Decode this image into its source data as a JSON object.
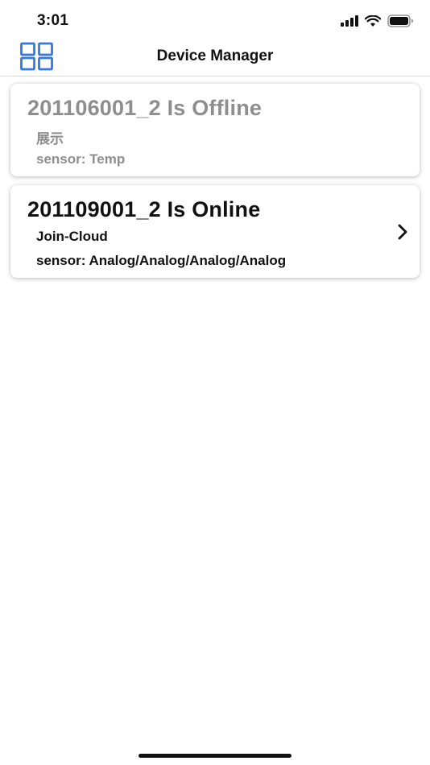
{
  "status_bar": {
    "time": "3:01",
    "icons": [
      "signal-icon",
      "wifi-icon",
      "battery-icon"
    ]
  },
  "nav": {
    "title": "Device Manager",
    "menu_icon": "grid-icon",
    "accent_color": "#3478e5"
  },
  "devices": [
    {
      "title": "201106001_2 Is Offline",
      "description": "展示",
      "sensor": "sensor: Temp",
      "status": "offline"
    },
    {
      "title": "201109001_2 Is Online",
      "description": "Join-Cloud",
      "sensor": "sensor: Analog/Analog/Analog/Analog",
      "status": "online"
    }
  ],
  "colors": {
    "offline_text": "#8e8e8e",
    "online_text": "#111111"
  }
}
